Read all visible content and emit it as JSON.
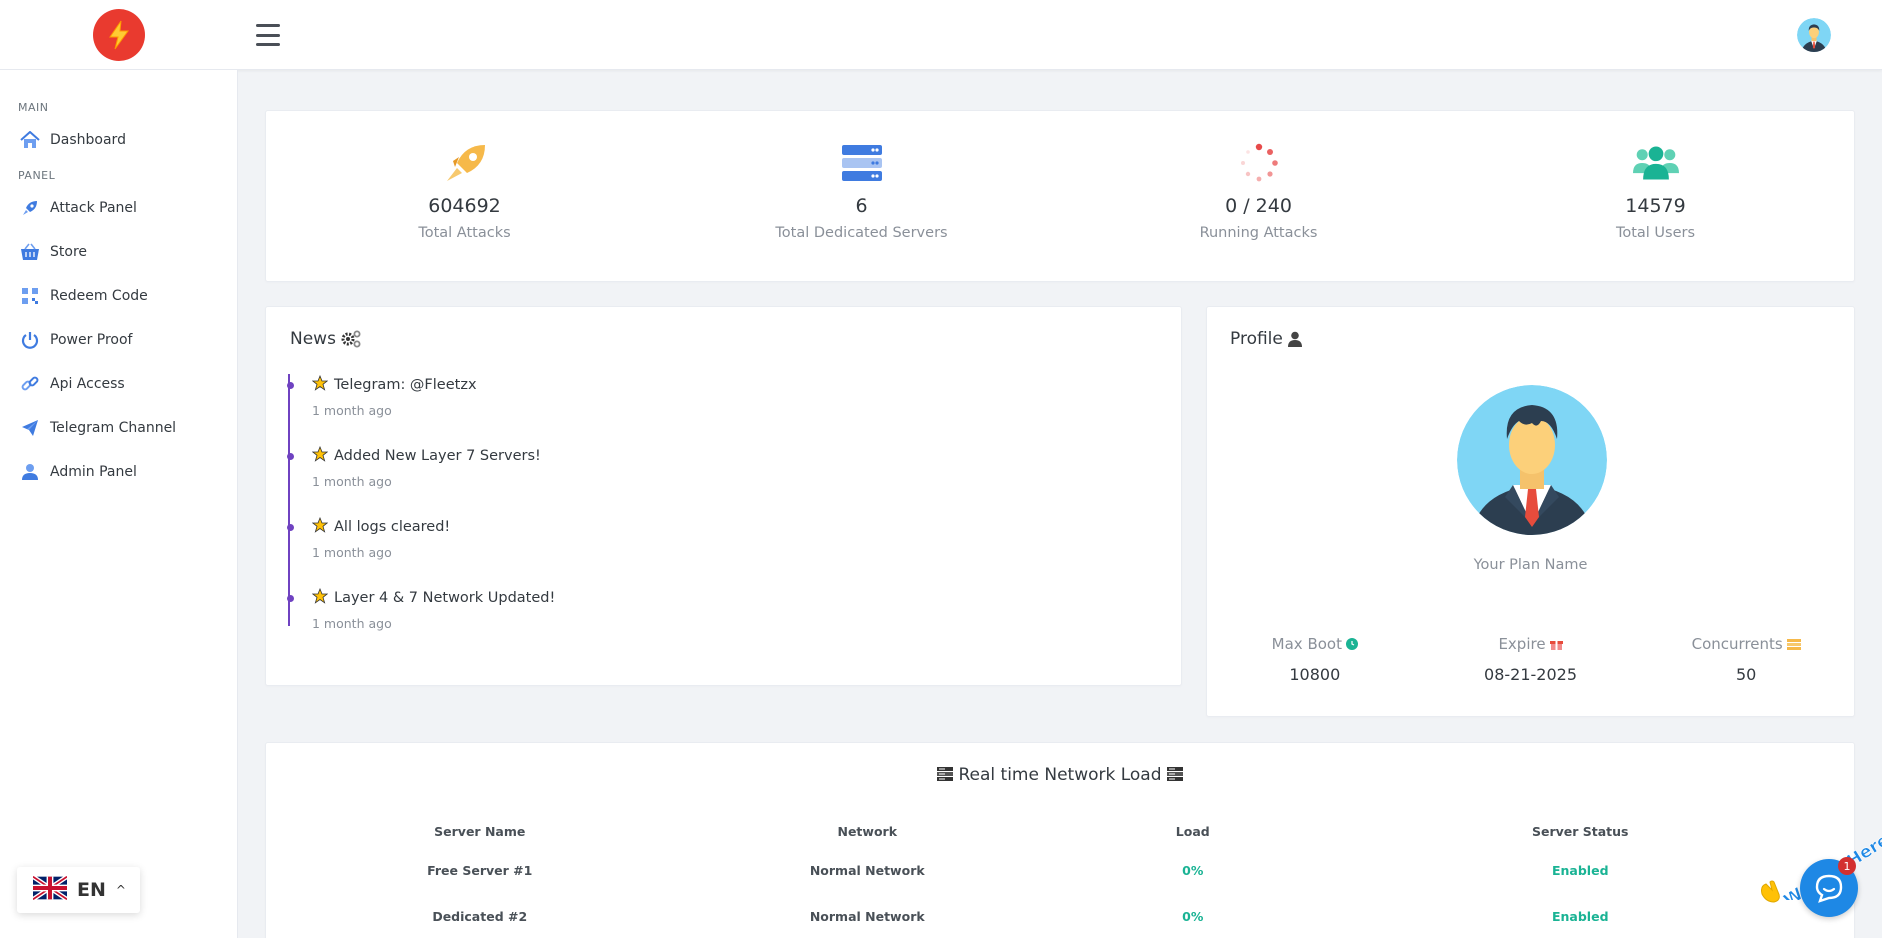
{
  "sidebar": {
    "sections": [
      {
        "heading": "MAIN",
        "items": [
          {
            "label": "Dashboard",
            "icon": "home-icon"
          }
        ]
      },
      {
        "heading": "PANEL",
        "items": [
          {
            "label": "Attack Panel",
            "icon": "rocket-icon"
          },
          {
            "label": "Store",
            "icon": "basket-icon"
          },
          {
            "label": "Redeem Code",
            "icon": "qrcode-icon"
          },
          {
            "label": "Power Proof",
            "icon": "power-icon"
          },
          {
            "label": "Api Access",
            "icon": "link-icon"
          },
          {
            "label": "Telegram Channel",
            "icon": "paper-plane-icon"
          },
          {
            "label": "Admin Panel",
            "icon": "user-icon"
          }
        ]
      }
    ],
    "language": "EN"
  },
  "stats": [
    {
      "value": "604692",
      "caption": "Total Attacks",
      "icon": "rocket-icon"
    },
    {
      "value": "6",
      "caption": "Total Dedicated Servers",
      "icon": "servers-icon"
    },
    {
      "value": "0 / 240",
      "caption": "Running Attacks",
      "icon": "spinner-icon"
    },
    {
      "value": "14579",
      "caption": "Total Users",
      "icon": "users-icon"
    }
  ],
  "news": {
    "title": "News",
    "items": [
      {
        "title": "Telegram: @Fleetzx",
        "time": "1 month ago"
      },
      {
        "title": "Added New Layer 7 Servers!",
        "time": "1 month ago"
      },
      {
        "title": "All logs cleared!",
        "time": "1 month ago"
      },
      {
        "title": "Layer 4 & 7 Network Updated!",
        "time": "1 month ago"
      }
    ]
  },
  "profile": {
    "title": "Profile",
    "plan_name": "Your Plan Name",
    "stats": [
      {
        "label": "Max Boot",
        "value": "10800",
        "icon": "clock-icon"
      },
      {
        "label": "Expire",
        "value": "08-21-2025",
        "icon": "gift-icon"
      },
      {
        "label": "Concurrents",
        "value": "50",
        "icon": "bars-icon"
      }
    ]
  },
  "network": {
    "title": "Real time Network Load",
    "columns": [
      "Server Name",
      "Network",
      "Load",
      "Server Status"
    ],
    "rows": [
      [
        "Free Server #1",
        "Normal Network",
        "0%",
        "Enabled"
      ],
      [
        "Dedicated #2",
        "Normal Network",
        "0%",
        "Enabled"
      ]
    ]
  },
  "chat": {
    "badge": "1",
    "greeting": "We Are Here!"
  },
  "colors": {
    "accent": "#6f42c1",
    "green": "#1ab394",
    "blue": "#3f7be0",
    "logo_red": "#e93a2f"
  }
}
